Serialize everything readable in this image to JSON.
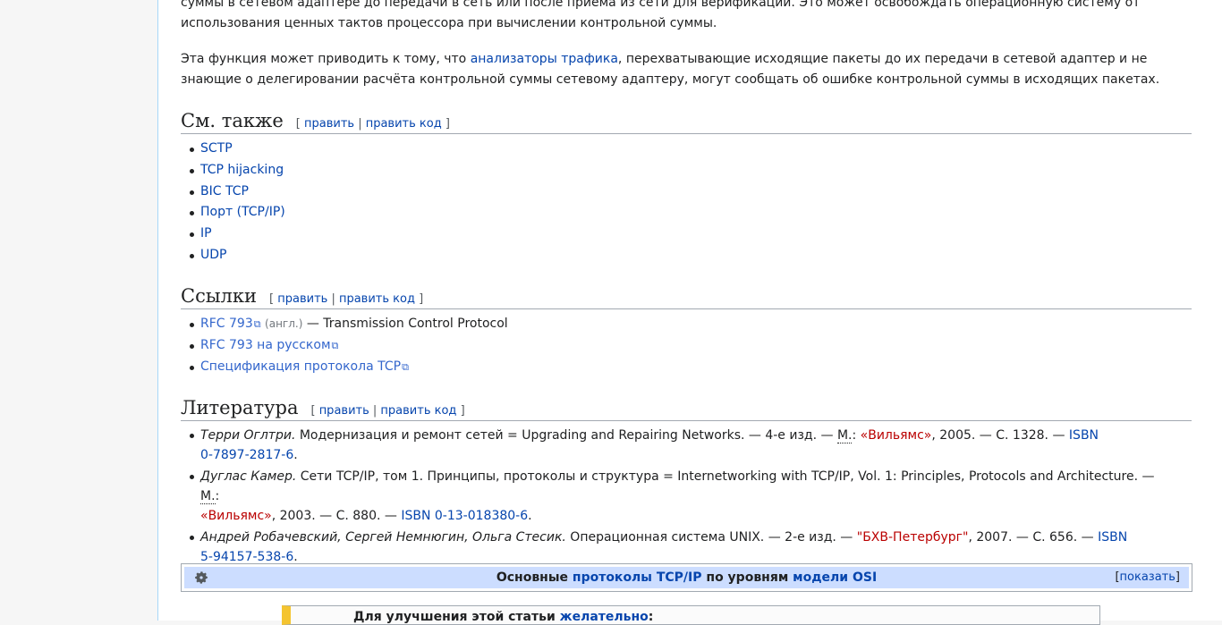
{
  "top_paragraph": {
    "line1": "суммы в сетевом адаптере до передачи в сеть или после приёма из сети для верификации. Это может освобождать операционную систему от",
    "line2": "использования ценных тактов процессора при вычислении контрольной суммы."
  },
  "para2": {
    "prefix": "Эта функция может приводить к тому, что ",
    "link": "анализаторы трафика",
    "suffix": ", перехватывающие исходящие пакеты до их передачи в сетевой адаптер и не",
    "line2": "знающие о делегировании расчёта контрольной суммы сетевому адаптеру, могут сообщать об ошибке контрольной суммы в исходящих пакетах."
  },
  "edit": {
    "open": "[",
    "edit": "править",
    "sep": "|",
    "edit_code": "править код",
    "close": "]"
  },
  "see_also": {
    "heading": "См. также",
    "items": [
      "SCTP",
      "TCP hijacking",
      "BIC TCP",
      "Порт (TCP/IP)",
      "IP",
      "UDP"
    ]
  },
  "links": {
    "heading": "Ссылки",
    "item1_link": "RFC 793",
    "item1_lang": "(англ.)",
    "item1_text": " — Transmission Control Protocol",
    "item2_link": "RFC 793 на русском",
    "item3_link": "Спецификация протокола TCP",
    "ext_icon": "external-link-icon"
  },
  "literature": {
    "heading": "Литература",
    "b1": {
      "author": "Терри Оглтри.",
      "text": " Модернизация и ремонт сетей = Upgrading and Repairing Networks. — 4-е изд. — ",
      "city": "М.",
      "colon": ": ",
      "publisher": "«Вильямс»",
      "rest": ", 2005. — С. 1328. — ",
      "isbn_label": "ISBN",
      "isbn": "0-7897-2817-6",
      "end": "."
    },
    "b2": {
      "author": "Дуглас Камер.",
      "text": " Сети TCP/IP, том 1. Принципы, протоколы и структура = Internetworking with TCP/IP, Vol. 1: Principles, Protocols and Architecture. — ",
      "city": "М.",
      "colon": ":",
      "publisher": "«Вильямс»",
      "rest": ", 2003. — С. 880. — ",
      "isbn": "ISBN 0-13-018380-6",
      "end": "."
    },
    "b3": {
      "author": "Андрей Робачевский, Сергей Немнюгин, Ольга Стесик.",
      "text": " Операционная система UNIX. — 2-е изд. — ",
      "publisher": "\"БХВ-Петербург\"",
      "rest": ", 2007. — С. 656. — ",
      "isbn_label": "ISBN",
      "isbn": "5-94157-538-6",
      "end": "."
    }
  },
  "navbox": {
    "t1": "Основные ",
    "link1": "протоколы TCP/IP",
    "t2": " по уровням ",
    "link2": "модели OSI",
    "toggle_open": "[",
    "toggle": "показать",
    "toggle_close": "]",
    "gear_icon": "gear-icon"
  },
  "ambox": {
    "text": "Для улучшения этой статьи ",
    "link": "желательно",
    "colon": ":"
  },
  "colors": {
    "link": "#0645ad",
    "red_link": "#ba0000",
    "navbox_title_bg": "#ccddff",
    "ambox_accent": "#f4c430"
  }
}
